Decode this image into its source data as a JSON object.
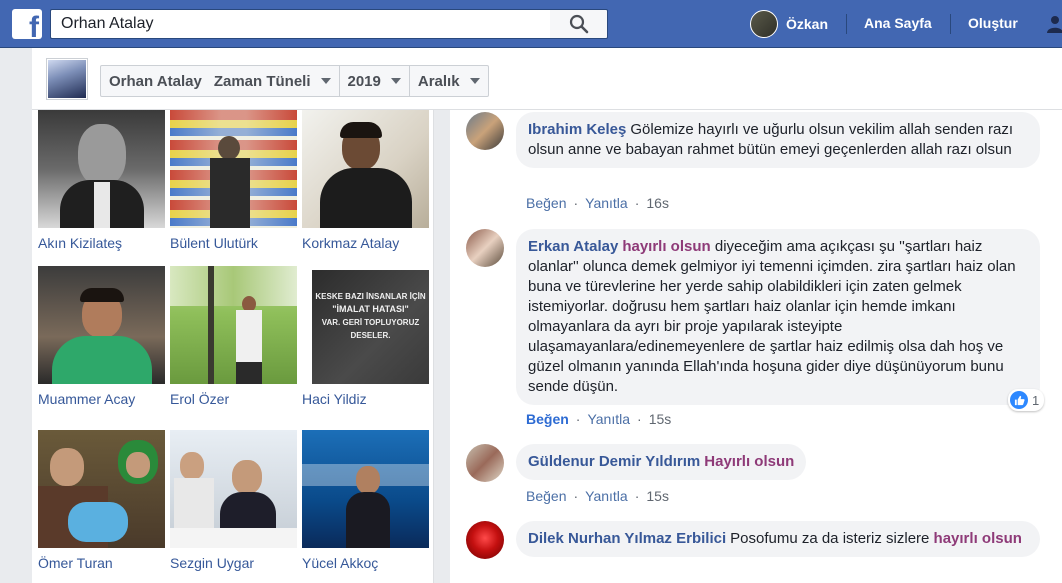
{
  "topbar": {
    "logo": "f",
    "search_value": "Orhan Atalay",
    "user_name": "Özkan",
    "home_label": "Ana Sayfa",
    "create_label": "Oluştur",
    "brand_color": "#4267b2"
  },
  "timeline_nav": {
    "profile_name": "Orhan Atalay",
    "section": "Zaman Tüneli",
    "year": "2019",
    "month": "Aralık"
  },
  "friends": [
    {
      "name": "Akın Kizilateş"
    },
    {
      "name": "Bülent Ulutürk"
    },
    {
      "name": "Korkmaz Atalay"
    },
    {
      "name": "Muammer Acay"
    },
    {
      "name": "Erol Özer"
    },
    {
      "name": "Haci Yildiz",
      "photo_text": [
        "KESKE BAZI İNSANLAR İÇİN",
        "\"İMALAT HATASI\"",
        "VAR. GERİ TOPLUYORUZ",
        "DESELER."
      ]
    },
    {
      "name": "Ömer Turan"
    },
    {
      "name": "Sezgin Uygar"
    },
    {
      "name": "Yücel Akkoç"
    }
  ],
  "comments": [
    {
      "author": "Ibrahim Keleş",
      "text": "Gölemize hayırlı ve uğurlu olsun vekilim allah senden razı olsun anne ve babayan rahmet bütün emeyi geçenlerden allah razı olsun",
      "like": "Beğen",
      "reply": "Yanıtla",
      "time": "16s"
    },
    {
      "author": "Erkan Atalay",
      "highlight": "hayırlı olsun",
      "text": "diyeceğim ama açıkçası şu ''şartları haiz olanlar'' olunca demek gelmiyor iyi temenni içimden. zira şartları haiz olan buna ve türevlerine her yerde sahip olabildikleri için zaten gelmek istemiyorlar. doğrusu hem şartları haiz olanlar için hemde imkanı olmayanlara da ayrı bir proje yapılarak isteyipte ulaşamayanlara/edinemeyenlere de şartlar haiz edilmiş olsa dah hoş ve güzel olmanın yanında Ellah'ında hoşuna gider diye düşünüyorum bunu sende düşün.",
      "like": "Beğen",
      "reply": "Yanıtla",
      "time": "15s",
      "reaction_count": "1"
    },
    {
      "author": "Güldenur Demir Yıldırım",
      "highlight": "Hayırlı olsun",
      "like": "Beğen",
      "reply": "Yanıtla",
      "time": "15s"
    },
    {
      "author": "Dilek Nurhan Yılmaz Erbilici",
      "text": "Posofumu za da isteriz sizlere",
      "highlight": "hayırlı olsun"
    }
  ]
}
